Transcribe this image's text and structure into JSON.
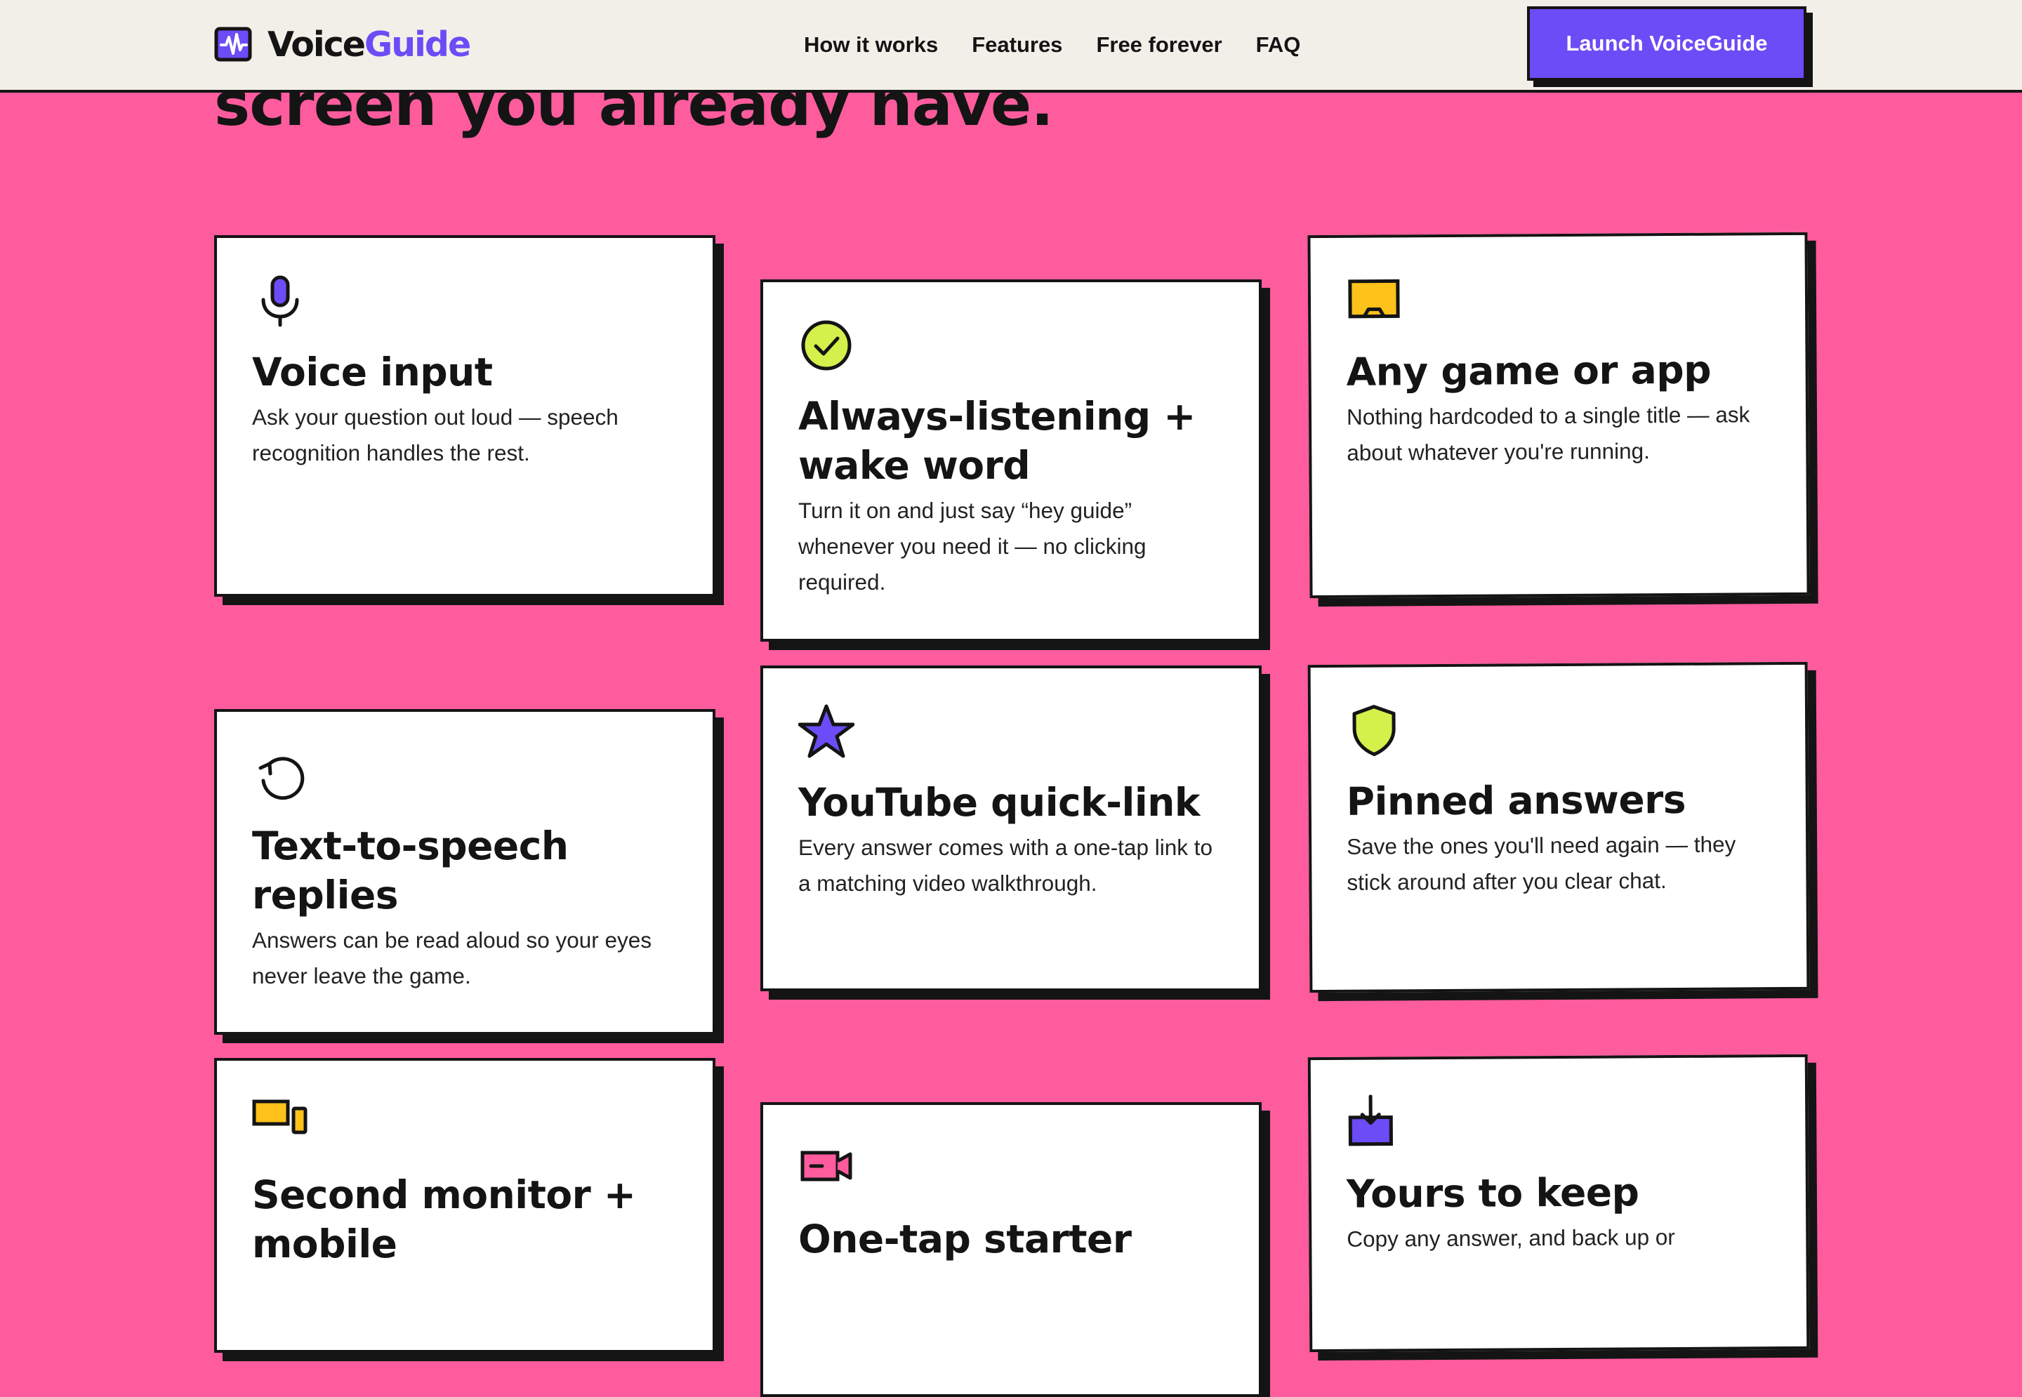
{
  "hero": {
    "title_tail": "screen you already have."
  },
  "header": {
    "logo": {
      "word_a": "Voice",
      "word_b": "Guide",
      "icon": "waveform-icon",
      "accent": "#6b4cf6"
    },
    "nav": [
      {
        "label": "How it works"
      },
      {
        "label": "Features"
      },
      {
        "label": "Free forever"
      },
      {
        "label": "FAQ"
      }
    ],
    "cta_label": "Launch VoiceGuide"
  },
  "features": [
    {
      "icon": "microphone-icon",
      "title": "Voice input",
      "body": "Ask your question out loud — speech recognition handles the rest."
    },
    {
      "icon": "check-circle-icon",
      "title": "Always-listening + wake word",
      "body": "Turn it on and just say “hey guide” whenever you need it — no clicking required."
    },
    {
      "icon": "screen-icon",
      "title": "Any game or app",
      "body": "Nothing hardcoded to a single title — ask about whatever you're running."
    },
    {
      "icon": "refresh-icon",
      "title": "Text-to-speech replies",
      "body": "Answers can be read aloud so your eyes never leave the game."
    },
    {
      "icon": "star-icon",
      "title": "YouTube quick-link",
      "body": "Every answer comes with a one-tap link to a matching video walkthrough."
    },
    {
      "icon": "shield-icon",
      "title": "Pinned answers",
      "body": "Save the ones you'll need again — they stick around after you clear chat."
    },
    {
      "icon": "monitor-phone-icon",
      "title": "Second monitor + mobile",
      "body": ""
    },
    {
      "icon": "video-camera-icon",
      "title": "One-tap starter",
      "body": ""
    },
    {
      "icon": "download-tray-icon",
      "title": "Yours to keep",
      "body": "Copy any answer, and back up or"
    }
  ],
  "colors": {
    "background": "#ff5c9e",
    "header_bg": "#f2efe8",
    "ink": "#141414",
    "purple": "#6b4cf6",
    "lime": "#d4f04a",
    "yellow": "#ffc21a",
    "pink": "#ff5c9e"
  }
}
